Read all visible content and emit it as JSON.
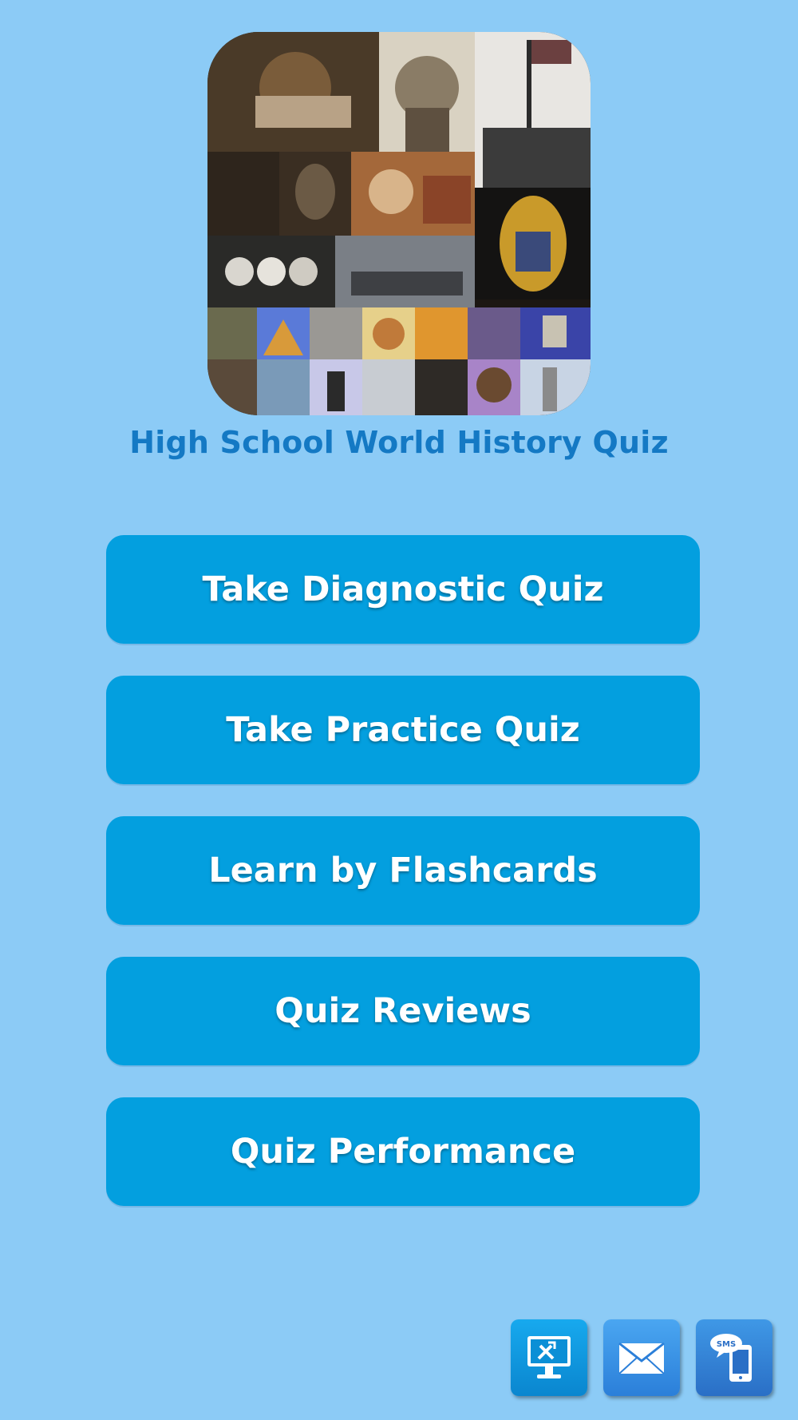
{
  "app": {
    "title": "High School World History Quiz"
  },
  "menu": {
    "items": [
      {
        "label": "Take Diagnostic Quiz"
      },
      {
        "label": "Take Practice Quiz"
      },
      {
        "label": "Learn by Flashcards"
      },
      {
        "label": "Quiz Reviews"
      },
      {
        "label": "Quiz Performance"
      }
    ]
  },
  "footer": {
    "sms_label": "SMS",
    "icons": [
      "desktop-tools-icon",
      "mail-icon",
      "sms-phone-icon"
    ]
  },
  "colors": {
    "background": "#8ccbf6",
    "button": "#039fdf",
    "title": "#1479c4"
  }
}
